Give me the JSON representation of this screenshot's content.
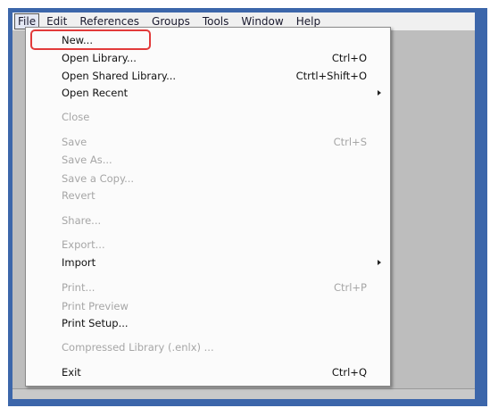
{
  "menubar": {
    "items": [
      "File",
      "Edit",
      "References",
      "Groups",
      "Tools",
      "Window",
      "Help"
    ],
    "active": "File"
  },
  "file_menu": {
    "new": {
      "label": "New...",
      "shortcut": ""
    },
    "open_library": {
      "label": "Open Library...",
      "shortcut": "Ctrl+O"
    },
    "open_shared_library": {
      "label": "Open Shared Library...",
      "shortcut": "Ctrtl+Shift+O"
    },
    "open_recent": {
      "label": "Open Recent",
      "shortcut": ""
    },
    "close": {
      "label": "Close",
      "shortcut": ""
    },
    "save": {
      "label": "Save",
      "shortcut": "Ctrl+S"
    },
    "save_as": {
      "label": "Save As...",
      "shortcut": ""
    },
    "save_a_copy": {
      "label": "Save a Copy...",
      "shortcut": ""
    },
    "revert": {
      "label": "Revert",
      "shortcut": ""
    },
    "share": {
      "label": "Share...",
      "shortcut": ""
    },
    "export": {
      "label": "Export...",
      "shortcut": ""
    },
    "import": {
      "label": "Import",
      "shortcut": ""
    },
    "print": {
      "label": "Print...",
      "shortcut": "Ctrl+P"
    },
    "print_preview": {
      "label": "Print Preview",
      "shortcut": ""
    },
    "print_setup": {
      "label": "Print Setup...",
      "shortcut": ""
    },
    "compressed_library": {
      "label": "Compressed Library (.enlx) ...",
      "shortcut": ""
    },
    "exit": {
      "label": "Exit",
      "shortcut": "Ctrl+Q"
    }
  },
  "colors": {
    "frame": "#3c66aa",
    "highlight_outline": "#e23a3a",
    "disabled_text": "#a6a6a6",
    "client_background": "#bdbdbd"
  },
  "icons": {
    "submenu_arrow": "chevron-right-icon"
  }
}
